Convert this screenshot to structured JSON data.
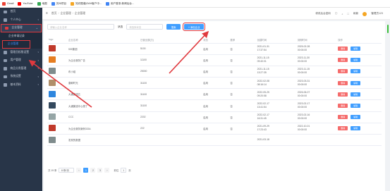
{
  "bookmarks": [
    {
      "label": "Gmail",
      "color": "#ea4335"
    },
    {
      "label": "YouTube",
      "color": "#ff0000"
    },
    {
      "label": "地图",
      "color": "#34a853"
    },
    {
      "label": "苏州项目",
      "color": "#4285f4"
    },
    {
      "label": "知识图谱|OAH客户中...",
      "color": "#f5a623"
    },
    {
      "label": "用户登录-新闻后台...",
      "color": "#4285f4"
    }
  ],
  "sidebar": {
    "items": [
      {
        "label": "首页",
        "icon": "home-icon"
      },
      {
        "label": "个人中心",
        "icon": "user-icon"
      },
      {
        "label": "企业管理",
        "icon": "building-icon"
      },
      {
        "label": "管理员权限设置",
        "icon": "lock-icon"
      },
      {
        "label": "用户管理",
        "icon": "users-icon"
      },
      {
        "label": "商品分类管理",
        "icon": "tag-icon"
      },
      {
        "label": "系统设置",
        "icon": "gear-icon"
      },
      {
        "label": "基本资料",
        "icon": "doc-icon"
      }
    ],
    "subitems": [
      "企业申请记录",
      "企业管理"
    ]
  },
  "topbar": {
    "breadcrumb": [
      "首页",
      "企业管理",
      "企业管理"
    ],
    "right": [
      "修改后台密码",
      "刷新",
      "管理员123"
    ]
  },
  "search": {
    "name_placeholder": "请输入企业名称",
    "status_label": "状态",
    "status_placeholder": "请选择状态",
    "search_btn": "搜索",
    "add_btn": "+ 添加企业"
  },
  "table": {
    "headers": [
      "logo",
      "企业名称",
      "日营业额(万)",
      "状态",
      "推荐",
      "创建时间",
      "到期时间",
      "操作"
    ],
    "rows": [
      {
        "thumb": "#c0392b",
        "name": "555集团",
        "rev": "5100",
        "status": "启用",
        "rec": "否",
        "created": [
          "2021-01-31",
          "17:37:54"
        ],
        "expire": [
          "2025-02-28",
          "00:00:00"
        ]
      },
      {
        "thumb": "#e67e22",
        "name": "为企业服务广告",
        "rev": "11100",
        "status": "启用",
        "rec": "否",
        "created": [
          "2021-11-15",
          "09:40:01"
        ],
        "expire": [
          "2023-11-30",
          "00:00:00"
        ]
      },
      {
        "thumb": "#7f8c8d",
        "name": "布小组",
        "rev": "25000",
        "status": "启用",
        "rec": "否",
        "created": [
          "2021-11-15",
          "13:27:35"
        ],
        "expire": [
          "2023-11-15",
          "00:00:00"
        ]
      },
      {
        "thumb": "#b08f6a",
        "name": "唐朝时光",
        "rev": "31100",
        "status": "启用",
        "rec": "否",
        "created": [
          "2022-02-08",
          "08:16:14"
        ],
        "expire": [
          "2023-03-31",
          "00:00:00"
        ]
      },
      {
        "thumb": "#2e86de",
        "name": "大通集团五",
        "rev": "31100",
        "status": "启用",
        "rec": "否",
        "created": [
          "2022-05-25",
          "09:20:58"
        ],
        "expire": [
          "2026-06-07",
          "00:00:00"
        ]
      },
      {
        "thumb": "#34495e",
        "name": "大通集团中心想了",
        "rev": "31100",
        "status": "启用",
        "rec": "否",
        "created": [
          "2022-02-17",
          "13:41:54"
        ],
        "expire": [
          "2023-02-17",
          "00:00:00"
        ]
      },
      {
        "thumb": "#95a5a6",
        "name": "CCC",
        "rev": "2202",
        "status": "启用",
        "rec": "否",
        "created": [
          "2022-02-17",
          "16:31:45"
        ],
        "expire": [
          "2023-02-16",
          "00:00:00"
        ]
      },
      {
        "thumb": "#c0392b",
        "name": "为企业服务案例333A",
        "rev": "222",
        "status": "启用",
        "rec": "否",
        "created": [
          "2021-09-29",
          "17:23:43"
        ],
        "expire": [
          "2022-10-01",
          "00:00:00"
        ]
      },
      {
        "thumb": "#7f8c8d",
        "name": "发现的数据",
        "rev": "",
        "status": "",
        "rec": "",
        "created": [
          "2021-03-18",
          ""
        ],
        "expire": [
          "",
          ""
        ]
      }
    ],
    "delete_label": "删除",
    "edit_label": "编辑"
  },
  "pager": {
    "total": "共 19 条",
    "size": "10条/页",
    "pages": [
      "1",
      "2",
      "3"
    ],
    "current": "1",
    "goto_label": "前往",
    "goto_value": "1",
    "page_suffix": "页"
  },
  "colors": {
    "annotation": "#e0393e",
    "primary": "#409eff",
    "sidebar": "#283548"
  }
}
